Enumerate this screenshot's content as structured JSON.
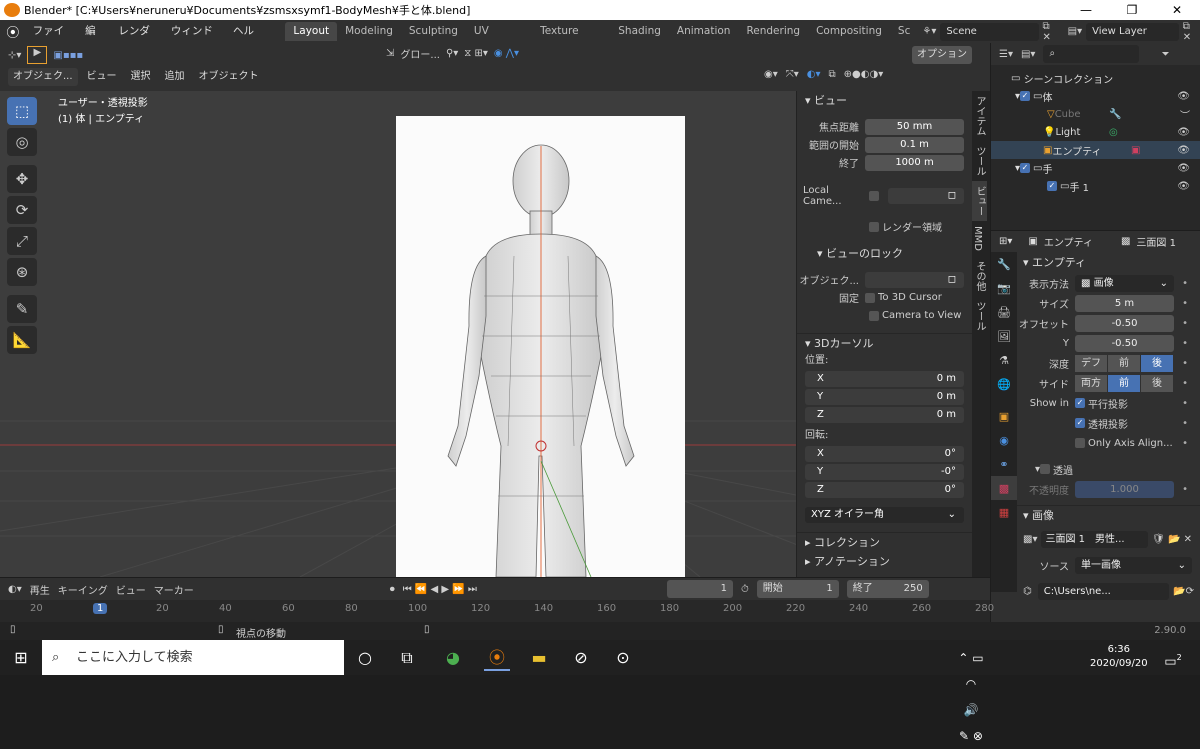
{
  "window": {
    "title": "Blender* [C:¥Users¥neruneru¥Documents¥zsmsxsymf1-BodyMesh¥手と体.blend]",
    "min": "—",
    "max": "❐",
    "close": "✕"
  },
  "menu": {
    "items": [
      "ファイル",
      "編集",
      "レンダー",
      "ウィンドウ",
      "ヘルプ"
    ]
  },
  "workspaces": {
    "tabs": [
      "Layout",
      "Modeling",
      "Sculpting",
      "UV Editing",
      "Texture Paint",
      "Shading",
      "Animation",
      "Rendering",
      "Compositing",
      "Sc"
    ],
    "active": "Layout"
  },
  "scene": {
    "name": "Scene",
    "view_layer": "View Layer"
  },
  "vp_header": {
    "mode": "オブジェク...",
    "items": [
      "ビュー",
      "選択",
      "追加",
      "オブジェクト"
    ],
    "transform": "グロー...",
    "options": "オプション"
  },
  "viewport": {
    "line1": "ユーザー・透視投影",
    "line2": "(1) 体 | エンプティ"
  },
  "npanel": {
    "view_title": "ビュー",
    "focal_label": "焦点距離",
    "focal": "50 mm",
    "clip_start_label": "範囲の開始",
    "clip_start": "0.1 m",
    "clip_end_label": "終了",
    "clip_end": "1000 m",
    "local_cam": "Local Came...",
    "render_region": "レンダー領域",
    "lock_title": "ビューのロック",
    "lock_obj": "オブジェク...",
    "lock_label": "固定",
    "to_cursor": "To 3D Cursor",
    "cam_to_view": "Camera to View",
    "cursor_title": "3Dカーソル",
    "location": "位置:",
    "loc": [
      {
        "a": "X",
        "v": "0 m"
      },
      {
        "a": "Y",
        "v": "0 m"
      },
      {
        "a": "Z",
        "v": "0 m"
      }
    ],
    "rotation": "回転:",
    "rot": [
      {
        "a": "X",
        "v": "0°"
      },
      {
        "a": "Y",
        "v": "-0°"
      },
      {
        "a": "Z",
        "v": "0°"
      }
    ],
    "euler": "XYZ オイラー角",
    "collection": "コレクション",
    "annotation": "アノテーション",
    "tabs": [
      "アイテム",
      "ツール",
      "ビュー",
      "MMD",
      "その他",
      "ツール"
    ]
  },
  "outliner": {
    "root": "シーンコレクション",
    "rows": [
      {
        "label": "体"
      },
      {
        "label": "Cube"
      },
      {
        "label": "Light"
      },
      {
        "label": "エンプティ"
      },
      {
        "label": "手"
      },
      {
        "label": "手 1"
      }
    ]
  },
  "properties": {
    "object": "エンプティ",
    "image_name": "三面図 1",
    "empty_title": "エンプティ",
    "display_label": "表示方法",
    "display": "画像",
    "size_label": "サイズ",
    "size": "5 m",
    "offset_label": "オフセット",
    "offset_x": "-0.50",
    "offset_y_label": "Y",
    "offset_y": "-0.50",
    "depth_label": "深度",
    "depth": [
      "デフ",
      "前",
      "後"
    ],
    "side_label": "サイド",
    "side": [
      "両方",
      "前",
      "後"
    ],
    "showin_label": "Show in",
    "ortho": "平行投影",
    "persp": "透視投影",
    "only_axis": "Only Axis Align...",
    "transp": "透過",
    "opacity_label": "不透明度",
    "opacity": "1.000",
    "image_title": "画像",
    "image_field": "三面図 1　男性...",
    "source_label": "ソース",
    "source": "単一画像",
    "path": "C:\\Users\\ne..."
  },
  "timeline": {
    "playback": "再生",
    "keying": "キーイング",
    "view": "ビュー",
    "marker": "マーカー",
    "frame": "1",
    "start_label": "開始",
    "start": "1",
    "end_label": "終了",
    "end": "250",
    "ticks": [
      "20",
      "1",
      "20",
      "40",
      "60",
      "80",
      "100",
      "120",
      "140",
      "160",
      "180",
      "200",
      "220",
      "240",
      "260",
      "280"
    ]
  },
  "status": {
    "hint": "視点の移動",
    "version": "2.90.0"
  },
  "taskbar": {
    "search": "ここに入力して検索",
    "time": "6:36",
    "date": "2020/09/20",
    "notif": "2"
  }
}
